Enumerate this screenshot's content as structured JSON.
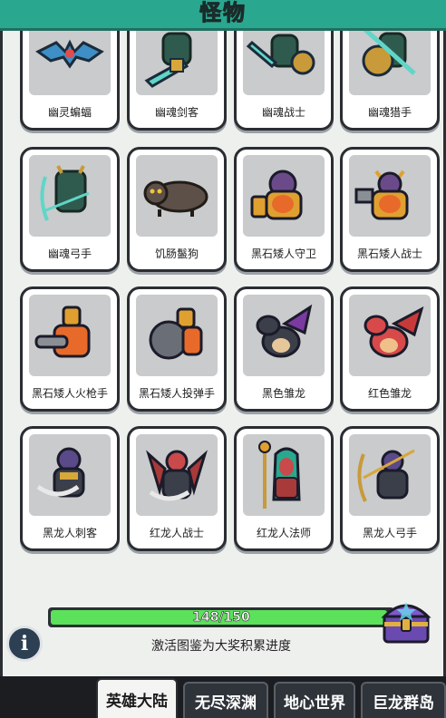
{
  "header": {
    "title": "怪物"
  },
  "monsters": [
    {
      "name": "幽灵蝙蝠",
      "icon": "ghost-bat"
    },
    {
      "name": "幽魂剑客",
      "icon": "ghost-swordsman"
    },
    {
      "name": "幽魂战士",
      "icon": "ghost-warrior"
    },
    {
      "name": "幽魂猎手",
      "icon": "ghost-hunter"
    },
    {
      "name": "幽魂弓手",
      "icon": "ghost-archer"
    },
    {
      "name": "饥肠鬣狗",
      "icon": "hungry-hyena"
    },
    {
      "name": "黑石矮人守卫",
      "icon": "blackrock-dwarf-guard"
    },
    {
      "name": "黑石矮人战士",
      "icon": "blackrock-dwarf-warrior"
    },
    {
      "name": "黑石矮人火枪手",
      "icon": "blackrock-dwarf-gunner"
    },
    {
      "name": "黑石矮人投弹手",
      "icon": "blackrock-dwarf-bomber"
    },
    {
      "name": "黑色雏龙",
      "icon": "black-whelp"
    },
    {
      "name": "红色雏龙",
      "icon": "red-whelp"
    },
    {
      "name": "黑龙人刺客",
      "icon": "black-dragonkin-assassin"
    },
    {
      "name": "红龙人战士",
      "icon": "red-dragonkin-warrior"
    },
    {
      "name": "红龙人法师",
      "icon": "red-dragonkin-mage"
    },
    {
      "name": "黑龙人弓手",
      "icon": "black-dragonkin-archer"
    }
  ],
  "progress": {
    "label": "148/150",
    "current": 148,
    "total": 150,
    "description": "激活图鉴为大奖积累进度"
  },
  "info_button": {
    "label": "i"
  },
  "tabs": [
    {
      "label": "英雄大陆",
      "active": true
    },
    {
      "label": "无尽深渊",
      "active": false
    },
    {
      "label": "地心世界",
      "active": false
    },
    {
      "label": "巨龙群岛",
      "active": false
    }
  ],
  "colors": {
    "header": "#2aa88f",
    "progress_fill": "#5be15a",
    "panel": "#eef0ee"
  }
}
